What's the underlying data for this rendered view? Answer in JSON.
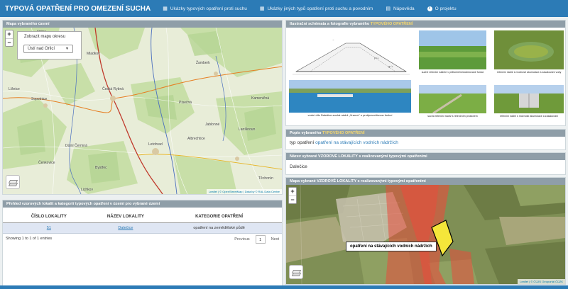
{
  "navbar": {
    "brand": "TYPOVÁ OPATŘENÍ PRO OMEZENÍ SUCHA",
    "links": [
      {
        "label": "Ukázky typových opatření proti suchu",
        "icon": "map-icon"
      },
      {
        "label": "Ukázky jiných typů opatření proti suchu a povodním",
        "icon": "map-icon"
      },
      {
        "label": "Nápověda",
        "icon": "book-icon"
      },
      {
        "label": "O projektu",
        "icon": "info-icon"
      }
    ]
  },
  "map_panel": {
    "heading": "Mapa vybraného území",
    "select_label": "Zobrazit mapu okresu",
    "select_value": "Ústí nad Orlicí",
    "attribution": "Leaflet | © OpenStreetMap | Data by © RAL Data Centre",
    "places": [
      "Orlice",
      "Mladkov",
      "Líšnice",
      "Sopotnice",
      "Žamberk",
      "Česká Rybná",
      "Písečná",
      "Kameničná",
      "Lanškroun",
      "Jablonné",
      "Albrechtice",
      "Dolní Čermná",
      "Čenkovice",
      "Bystřec",
      "Letohrad",
      "Těchonín",
      "Lichkov"
    ]
  },
  "table_panel": {
    "heading": "Přehled vzorových lokalit a kategorií typových opatření v území pro vybrané území",
    "columns": [
      "ČÍSLO LOKALITY",
      "NÁZEV LOKALITY",
      "KATEGORIE OPATŘENÍ"
    ],
    "rows": [
      {
        "number": "51",
        "name": "Dalečice",
        "category": "opatření na zemědělské půdě"
      }
    ],
    "info": "Showing 1 to 1 of 1 entries",
    "previous": "Previous",
    "page": "1",
    "next": "Next"
  },
  "photo_panel": {
    "heading_prefix": "Ilustrační schémata a fotografie vybraného ",
    "heading_highlight": "TYPOVÉHO OPATŘENÍ",
    "captions": [
      "suché retenční nádrže v průtočné/nedodržované funkci",
      "retenční nádrž s možností akumulace a zasakování vody",
      "vodní dílo Dalešice-suchá nádrž „Vranov\" s protipovodňovou funkcí",
      "suchá retenční nádrž s retenčním prostorem",
      "retenční nádrž s možností akumulace a zasakování"
    ]
  },
  "description_panel": {
    "heading_prefix": "Popis vybraného ",
    "heading_highlight": "TYPOVÉHO OPATŘENÍ",
    "label": "typ opatření",
    "value": "opatření na stávajících vodních nádržích"
  },
  "locality_panel": {
    "heading": "Název vybrané VZOROVÉ LOKALITY s realizovanými typovými opatřeními",
    "value": "Dalečice"
  },
  "locality_map_panel": {
    "heading": "Mapa vybrané VZOROVÉ LOKALITY s realizovanými typovými opatřeními",
    "tooltip": "opatření na stávajících vodních nádržích",
    "attribution": "Leaflet | © ČÚZK Geoportál ČÚZK"
  }
}
